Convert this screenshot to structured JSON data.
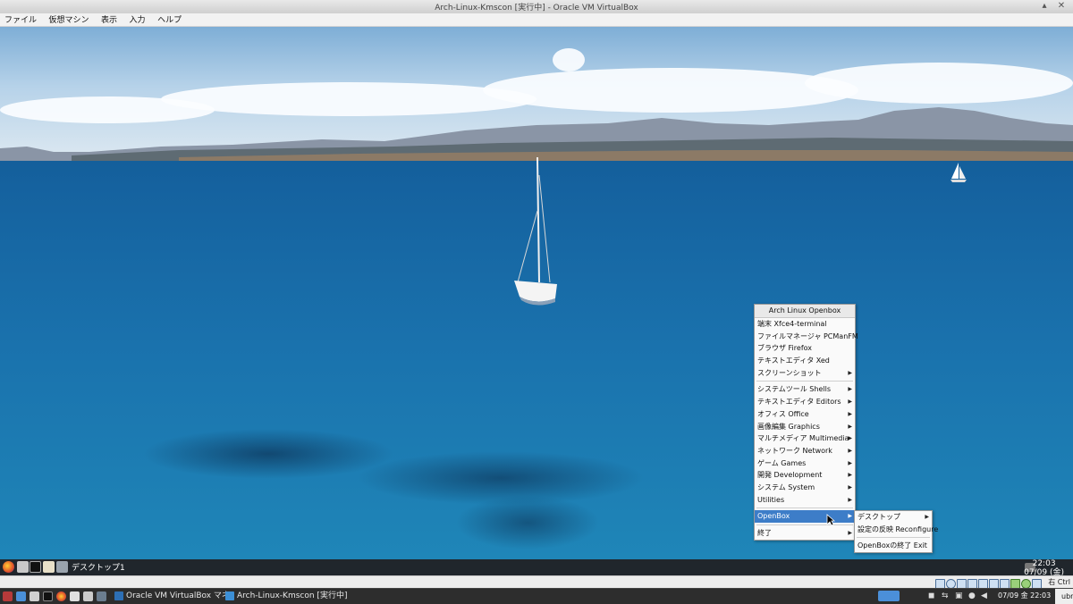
{
  "window": {
    "title": "Arch-Linux-Kmscon [実行中] - Oracle VM VirtualBox",
    "controls": {
      "up": "▴",
      "close": "✕"
    }
  },
  "vbox_menu": [
    "ファイル",
    "仮想マシン",
    "表示",
    "入力",
    "ヘルプ"
  ],
  "openbox_menu": {
    "title": "Arch Linux Openbox",
    "items": [
      {
        "label": "端末 Xfce4-terminal",
        "submenu": false
      },
      {
        "label": "ファイルマネージャ PCManFM",
        "submenu": false
      },
      {
        "label": "ブラウザ Firefox",
        "submenu": false
      },
      {
        "label": "テキストエディタ Xed",
        "submenu": false
      },
      {
        "label": "スクリーンショット",
        "submenu": true
      },
      {
        "label": "システムツール Shells",
        "submenu": true
      },
      {
        "label": "テキストエディタ Editors",
        "submenu": true
      },
      {
        "label": "オフィス Office",
        "submenu": true
      },
      {
        "label": "画像編集 Graphics",
        "submenu": true
      },
      {
        "label": "マルチメディア Multimedia",
        "submenu": true
      },
      {
        "label": "ネットワーク Network",
        "submenu": true
      },
      {
        "label": "ゲーム Games",
        "submenu": true
      },
      {
        "label": "開発 Development",
        "submenu": true
      },
      {
        "label": "システム System",
        "submenu": true
      },
      {
        "label": "Utilities",
        "submenu": true
      },
      {
        "label": "OpenBox",
        "submenu": true
      },
      {
        "label": "終了",
        "submenu": true
      }
    ],
    "arrow": "▶"
  },
  "openbox_submenu": {
    "items": [
      "デスクトップ",
      "設定の反映 Reconfigure",
      "OpenBoxの終了 Exit"
    ]
  },
  "guest_panel": {
    "desktop_label": "デスクトップ1",
    "time": "22:03",
    "date": "07/09 (金)"
  },
  "vbox_status": {
    "host_key": "右 Ctrl"
  },
  "host_taskbar": {
    "tasks": [
      "Oracle VM VirtualBox マネー...",
      "Arch-Linux-Kmscon [実行中] ..."
    ],
    "clock": "07/09 金 22:03",
    "user": "ubn"
  },
  "colors": {
    "menu_highlight": "#3d7dc8",
    "sea": "#1a72ad",
    "panel": "#20262c",
    "host_taskbar": "#2d2d2d"
  },
  "icons": [
    "firefox-icon",
    "file-manager-icon",
    "terminal-icon",
    "text-editor-icon",
    "screenshot-icon"
  ]
}
